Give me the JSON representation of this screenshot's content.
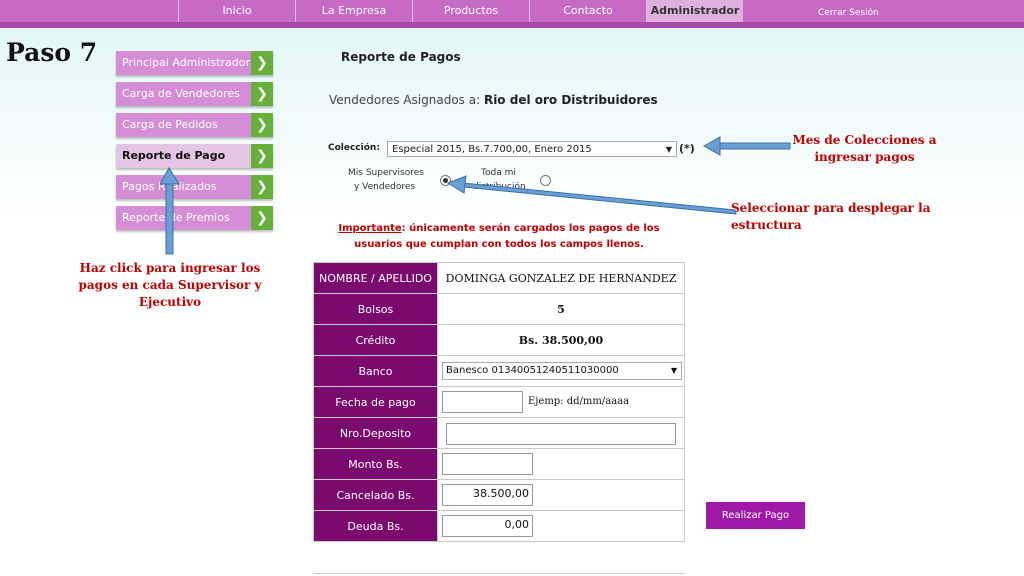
{
  "nav": {
    "items": [
      {
        "label": "Inicio"
      },
      {
        "label": "La Empresa"
      },
      {
        "label": "Productos"
      },
      {
        "label": "Contacto"
      },
      {
        "label": "Administrador"
      }
    ],
    "logout": "Cerrar Sesión"
  },
  "step_title": "Paso 7",
  "menu": {
    "items": [
      {
        "label": "Principal Administrador"
      },
      {
        "label": "Carga de Vendedores"
      },
      {
        "label": "Carga de Pedidos"
      },
      {
        "label": "Reporte de Pago"
      },
      {
        "label": "Pagos Realizados"
      },
      {
        "label": "Reporte de Premios"
      }
    ],
    "arrow": "❯"
  },
  "report": {
    "title": "Reporte de Pagos",
    "assigned_prefix": "Vendedores Asignados a: ",
    "assigned_name": "Rio del oro Distribuidores"
  },
  "coleccion": {
    "label": "Colección:",
    "selected": "Especial 2015, Bs.7.700,00, Enero 2015",
    "required_mark": "(*)"
  },
  "radios": {
    "option1_line1": "Mis Supervisores",
    "option1_line2": "y Vendedores",
    "option2_line1": "Toda mi",
    "option2_line2": "distribución"
  },
  "importante": {
    "label": "Importante",
    "text": ": únicamente serán cargados los pagos de los usuarios que cumplan con todos los campos llenos."
  },
  "table": {
    "nombre_label": "NOMBRE / APELLIDO",
    "nombre_value": "DOMINGA GONZALEZ DE HERNANDEZ",
    "bolsos_label": "Bolsos",
    "bolsos_value": "5",
    "credito_label": "Crédito",
    "credito_value": "Bs. 38.500,00",
    "banco_label": "Banco",
    "banco_value": "Banesco 01340051240511030000",
    "fecha_label": "Fecha de pago",
    "fecha_value": "",
    "fecha_hint": "Ejemp: dd/mm/aaaa",
    "deposito_label": "Nro.Deposito",
    "deposito_value": "",
    "monto_label": "Monto Bs.",
    "monto_value": "",
    "cancelado_label": "Cancelado Bs.",
    "cancelado_value": "38.500,00",
    "deuda_label": "Deuda Bs.",
    "deuda_value": "0,00"
  },
  "pay_button": "Realizar Pago",
  "annotations": {
    "colecciones": "Mes de Colecciones a ingresar pagos",
    "seleccionar": "Seleccionar para desplegar la estructura",
    "click": "Haz click para ingresar los pagos en cada Supervisor y Ejecutivo"
  },
  "colors": {
    "topbar": "#c66ac6",
    "menu_button": "#d58ed5",
    "menu_arrow": "#67b13a",
    "table_label": "#7a0a6e",
    "annotation": "#c00000",
    "arrow": "#6a9fd4"
  }
}
